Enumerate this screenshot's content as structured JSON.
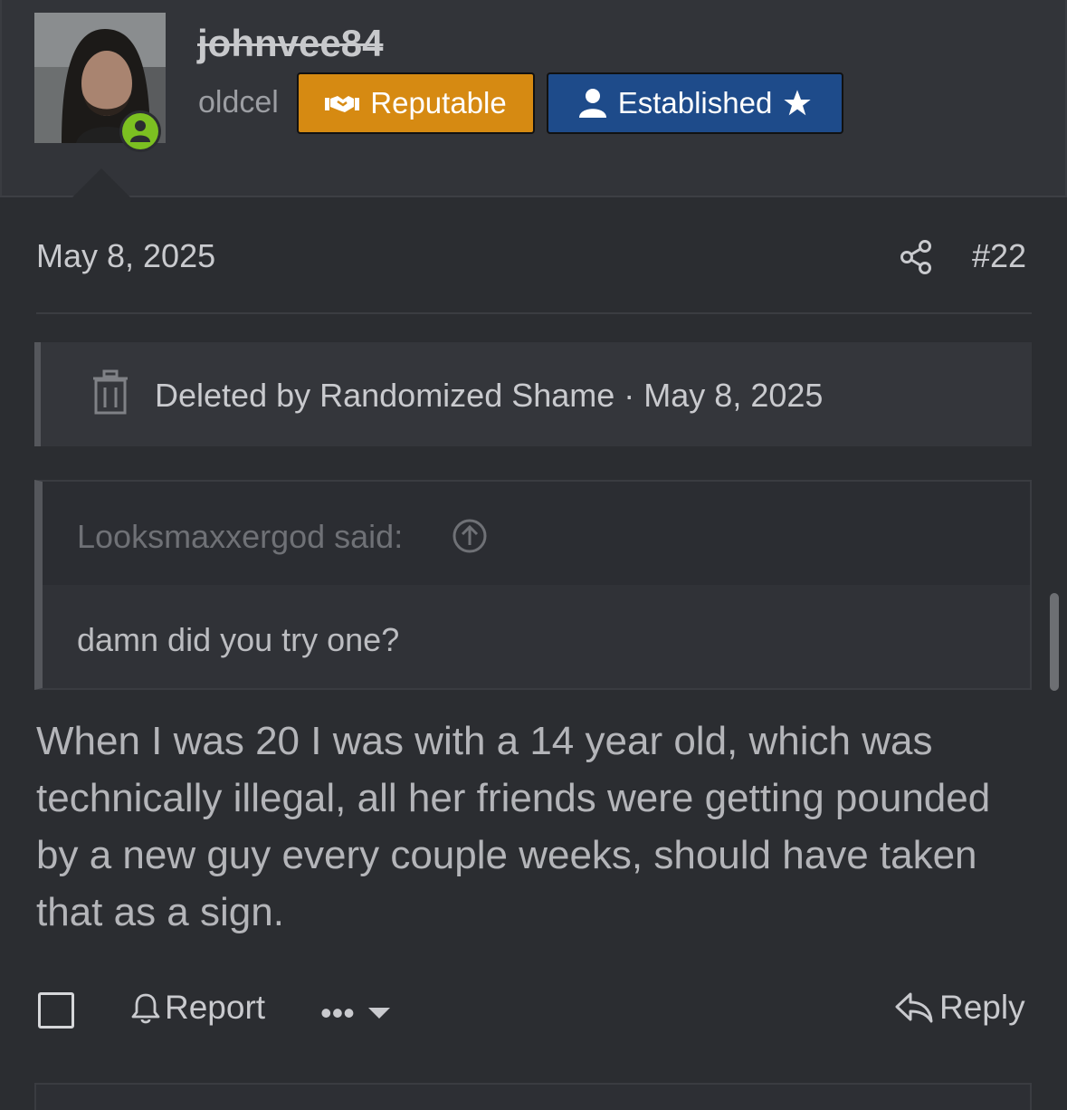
{
  "user": {
    "username": "johnvee84",
    "title": "oldcel",
    "status": "online",
    "badges": [
      {
        "label": "Reputable",
        "icon": "handshake-icon",
        "color": "#d68a12"
      },
      {
        "label": "Established",
        "icon": "user-icon",
        "suffix_icon": "star-icon",
        "color": "#1e4b8a"
      }
    ]
  },
  "post": {
    "date": "May 8, 2025",
    "number": "#22",
    "deleted_notice": "Deleted by Randomized Shame · May 8, 2025",
    "quote": {
      "attribution": "Looksmaxxergod said:",
      "text": "damn did you try one?"
    },
    "message": "When I was 20 I was with a 14 year old, which was technically illegal, all her friends were getting pounded by a new guy every couple weeks, should have taken that as a sign."
  },
  "actions": {
    "report_label": "Report",
    "more_label": "•••",
    "reply_label": "Reply"
  }
}
